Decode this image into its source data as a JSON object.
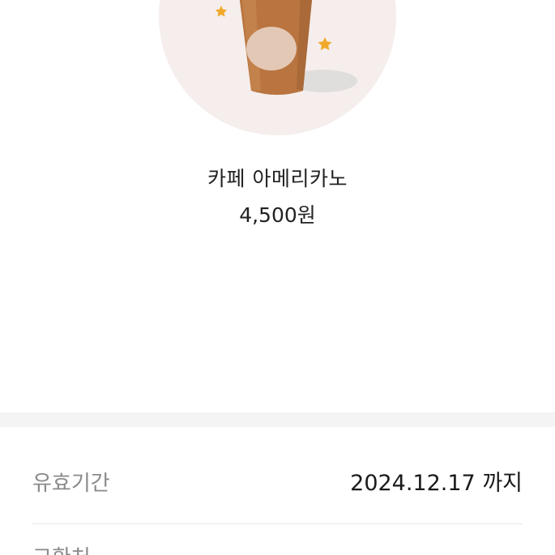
{
  "product": {
    "name": "카페 아메리카노",
    "price": "4,500원"
  },
  "info": {
    "validity_label": "유효기간",
    "validity_value": "2024.12.17 까지",
    "next_label": "교환처"
  },
  "colors": {
    "hero_bg": "#f5eeec",
    "cup": "#b9743f",
    "star": "#f0a92a",
    "divider": "#f4f4f4"
  },
  "icons": {
    "product_image": "iced-americano-cup-icon",
    "decoration": "star-icon"
  }
}
